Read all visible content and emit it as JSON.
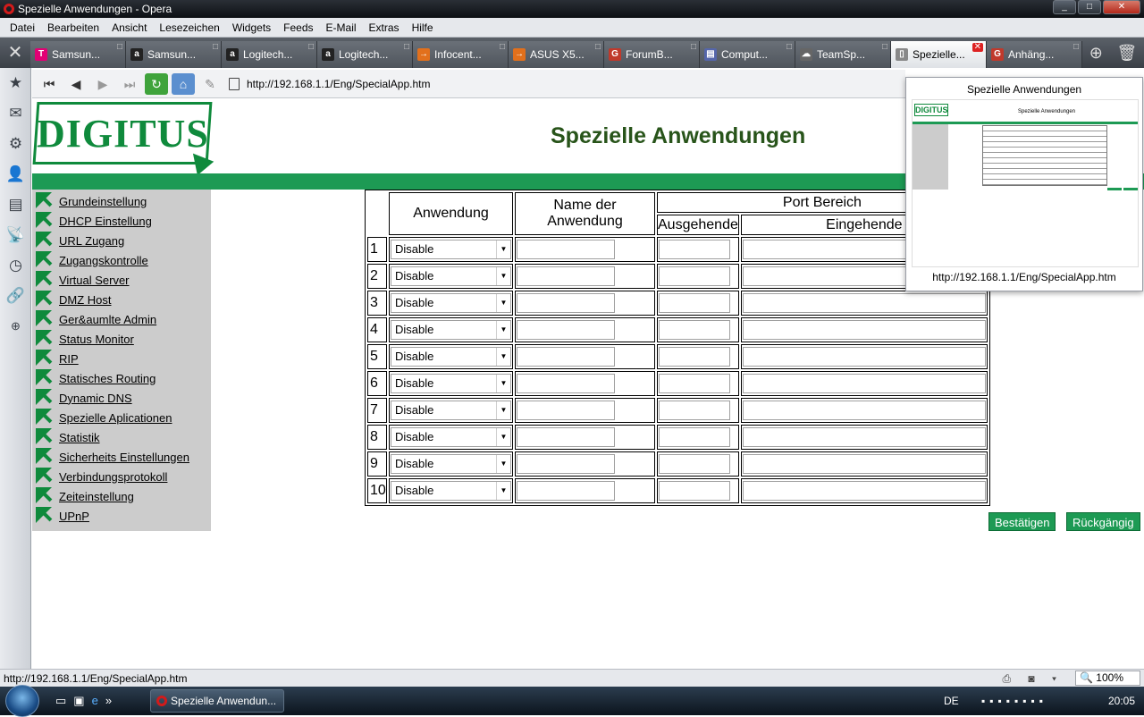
{
  "window": {
    "title": "Spezielle Anwendungen - Opera",
    "buttons": [
      "_",
      "□",
      "✕"
    ]
  },
  "menubar": [
    "Datei",
    "Bearbeiten",
    "Ansicht",
    "Lesezeichen",
    "Widgets",
    "Feeds",
    "E-Mail",
    "Extras",
    "Hilfe"
  ],
  "tabs": [
    {
      "label": "Samsun...",
      "icon": "T",
      "color": "#e20074"
    },
    {
      "label": "Samsun...",
      "icon": "a",
      "color": "#222222"
    },
    {
      "label": "Logitech...",
      "icon": "a",
      "color": "#222222"
    },
    {
      "label": "Logitech...",
      "icon": "a",
      "color": "#222222"
    },
    {
      "label": "Infocent...",
      "icon": "→",
      "color": "#e2701c"
    },
    {
      "label": "ASUS X5...",
      "icon": "→",
      "color": "#e2701c"
    },
    {
      "label": "ForumB...",
      "icon": "G",
      "color": "#c0392b"
    },
    {
      "label": "Comput...",
      "icon": "▤",
      "color": "#5566aa"
    },
    {
      "label": "TeamSp...",
      "icon": "☁",
      "color": "#666666"
    },
    {
      "label": "Spezielle...",
      "icon": "▯",
      "color": "#888888",
      "active": true
    },
    {
      "label": "Anhäng...",
      "icon": "G",
      "color": "#c0392b"
    }
  ],
  "address": {
    "url": "http://192.168.1.1/Eng/SpecialApp.htm"
  },
  "page": {
    "logo": "DIGITUS",
    "title": "Spezielle Anwendungen",
    "nav": [
      "Grundeinstellung",
      "DHCP Einstellung",
      "URL Zugang",
      "Zugangskontrolle",
      "Virtual Server",
      "DMZ Host",
      "Ger&aumlte Admin",
      "Status Monitor",
      "RIP",
      "Statisches Routing",
      "Dynamic DNS",
      "Spezielle Aplicationen",
      "Statistik",
      "Sicherheits Einstellungen",
      "Verbindungsprotokoll",
      "Zeiteinstellung",
      "UPnP"
    ],
    "table": {
      "col_app": "Anwendung",
      "col_name": "Name der Anwendung",
      "col_port": "Port Bereich",
      "col_out": "Ausgehende",
      "col_in": "Eingehende",
      "rows": [
        {
          "num": "1",
          "sel": "Disable"
        },
        {
          "num": "2",
          "sel": "Disable"
        },
        {
          "num": "3",
          "sel": "Disable"
        },
        {
          "num": "4",
          "sel": "Disable"
        },
        {
          "num": "5",
          "sel": "Disable"
        },
        {
          "num": "6",
          "sel": "Disable"
        },
        {
          "num": "7",
          "sel": "Disable"
        },
        {
          "num": "8",
          "sel": "Disable"
        },
        {
          "num": "9",
          "sel": "Disable"
        },
        {
          "num": "10",
          "sel": "Disable"
        }
      ]
    },
    "btn_confirm": "Bestätigen",
    "btn_undo": "Rückgängig"
  },
  "thumb": {
    "title": "Spezielle Anwendungen",
    "url": "http://192.168.1.1/Eng/SpecialApp.htm",
    "mini_logo": "DIGITUS",
    "mini_title": "Spezielle Anwendungen"
  },
  "status": {
    "url": "http://192.168.1.1/Eng/SpecialApp.htm",
    "zoom": "100%"
  },
  "taskbar": {
    "task": "Spezielle Anwendun...",
    "lang": "DE",
    "time": "20:05"
  },
  "colors": {
    "green": "#1d9a54",
    "title": "#28541a"
  }
}
